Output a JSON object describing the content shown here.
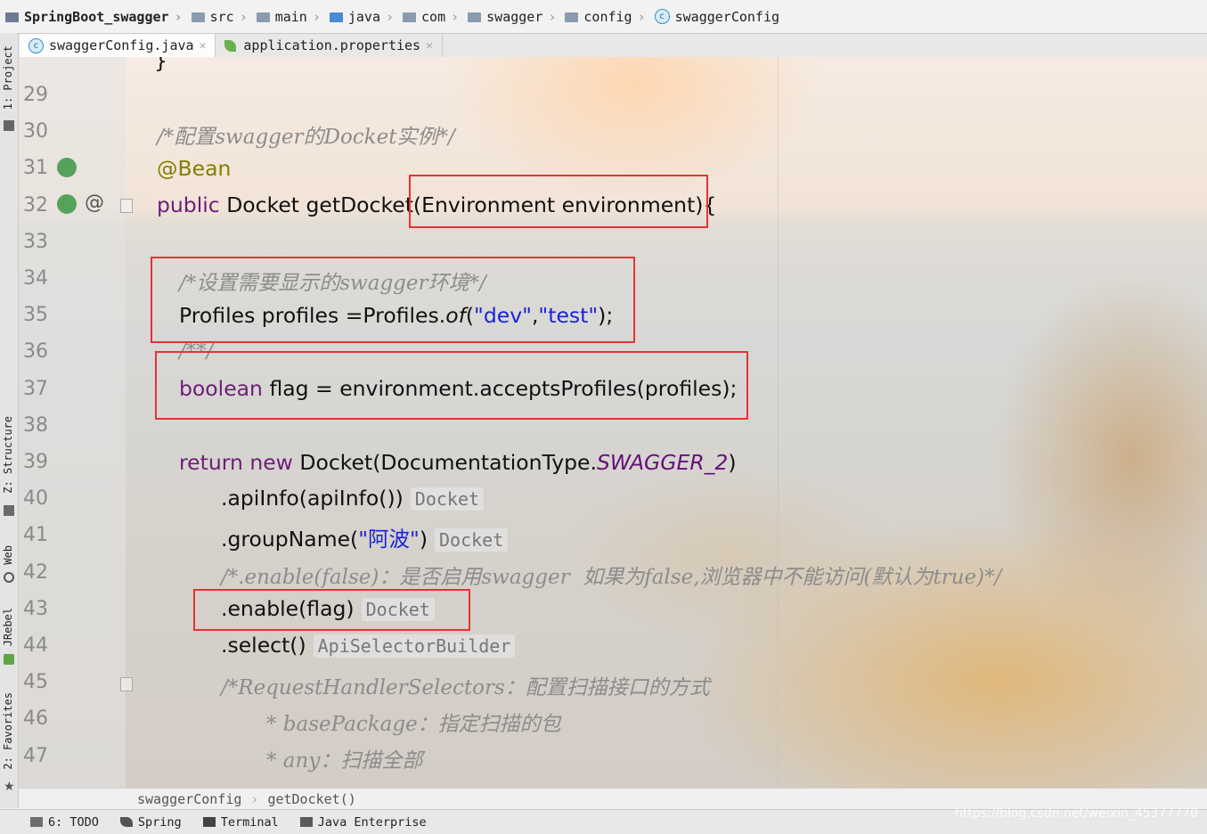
{
  "breadcrumb": {
    "items": [
      "SpringBoot_swagger",
      "src",
      "main",
      "java",
      "com",
      "swagger",
      "config",
      "swaggerConfig"
    ]
  },
  "tabs": [
    {
      "label": "swaggerConfig.java",
      "icon": "class-icon",
      "active": true
    },
    {
      "label": "application.properties",
      "icon": "spring-leaf-icon",
      "active": false
    }
  ],
  "left_strip": {
    "project": "1: Project",
    "structure": "Z: Structure",
    "web": "Web",
    "jrebel": "JRebel",
    "favorites": "2: Favorites"
  },
  "editor": {
    "line_numbers": [
      "29",
      "30",
      "31",
      "32",
      "33",
      "34",
      "35",
      "36",
      "37",
      "38",
      "39",
      "40",
      "41",
      "42",
      "43",
      "44",
      "45",
      "46",
      "47"
    ],
    "code": {
      "l30_comment": "/*配置swagger的Docket实例*/",
      "l31_annotation": "@Bean",
      "l32_kw": "public",
      "l32_rest": " Docket getDocket(Environment environment){",
      "l34_comment": "/*设置需要显示的swagger环境*/",
      "l35_a": "Profiles profiles =Profiles.",
      "l35_of": "of",
      "l35_b": "(",
      "l35_s1": "\"dev\"",
      "l35_c": ",",
      "l35_s2": "\"test\"",
      "l35_d": ");",
      "l36_comment": "/**/",
      "l37_kw": "boolean",
      "l37_rest": " flag = environment.acceptsProfiles(profiles);",
      "l39_kw": "return new",
      "l39_a": " Docket(DocumentationType.",
      "l39_static": "SWAGGER_2",
      "l39_b": ")",
      "l40": ".apiInfo(apiInfo())",
      "l41_a": ".groupName(",
      "l41_str": "\"阿波\"",
      "l41_b": ")",
      "l42_comment": "/*.enable(false)：是否启用swagger  如果为false,浏览器中不能访问(默认为true)*/",
      "l43": ".enable(flag)",
      "l44": ".select()",
      "l45_comment": "/*RequestHandlerSelectors：配置扫描接口的方式",
      "l46_comment": "* basePackage：指定扫描的包",
      "l47_comment": "* any：扫描全部"
    },
    "hints": {
      "docket": "Docket",
      "api_selector_builder": "ApiSelectorBuilder"
    }
  },
  "editor_breadcrumb": [
    "swaggerConfig",
    "getDocket()"
  ],
  "tool_windows": [
    {
      "label": "6: TODO",
      "icon": "todo-icon"
    },
    {
      "label": "Spring",
      "icon": "spring-icon"
    },
    {
      "label": "Terminal",
      "icon": "terminal-icon"
    },
    {
      "label": "Java Enterprise",
      "icon": "java-enterprise-icon"
    }
  ],
  "watermark": "https://blog.csdn.net/weixin_45377770",
  "colors": {
    "keyword": "#000080",
    "string": "#1a23d8",
    "annotation": "#808000",
    "comment": "#8c8c8c",
    "highlight_box": "#e53333"
  }
}
